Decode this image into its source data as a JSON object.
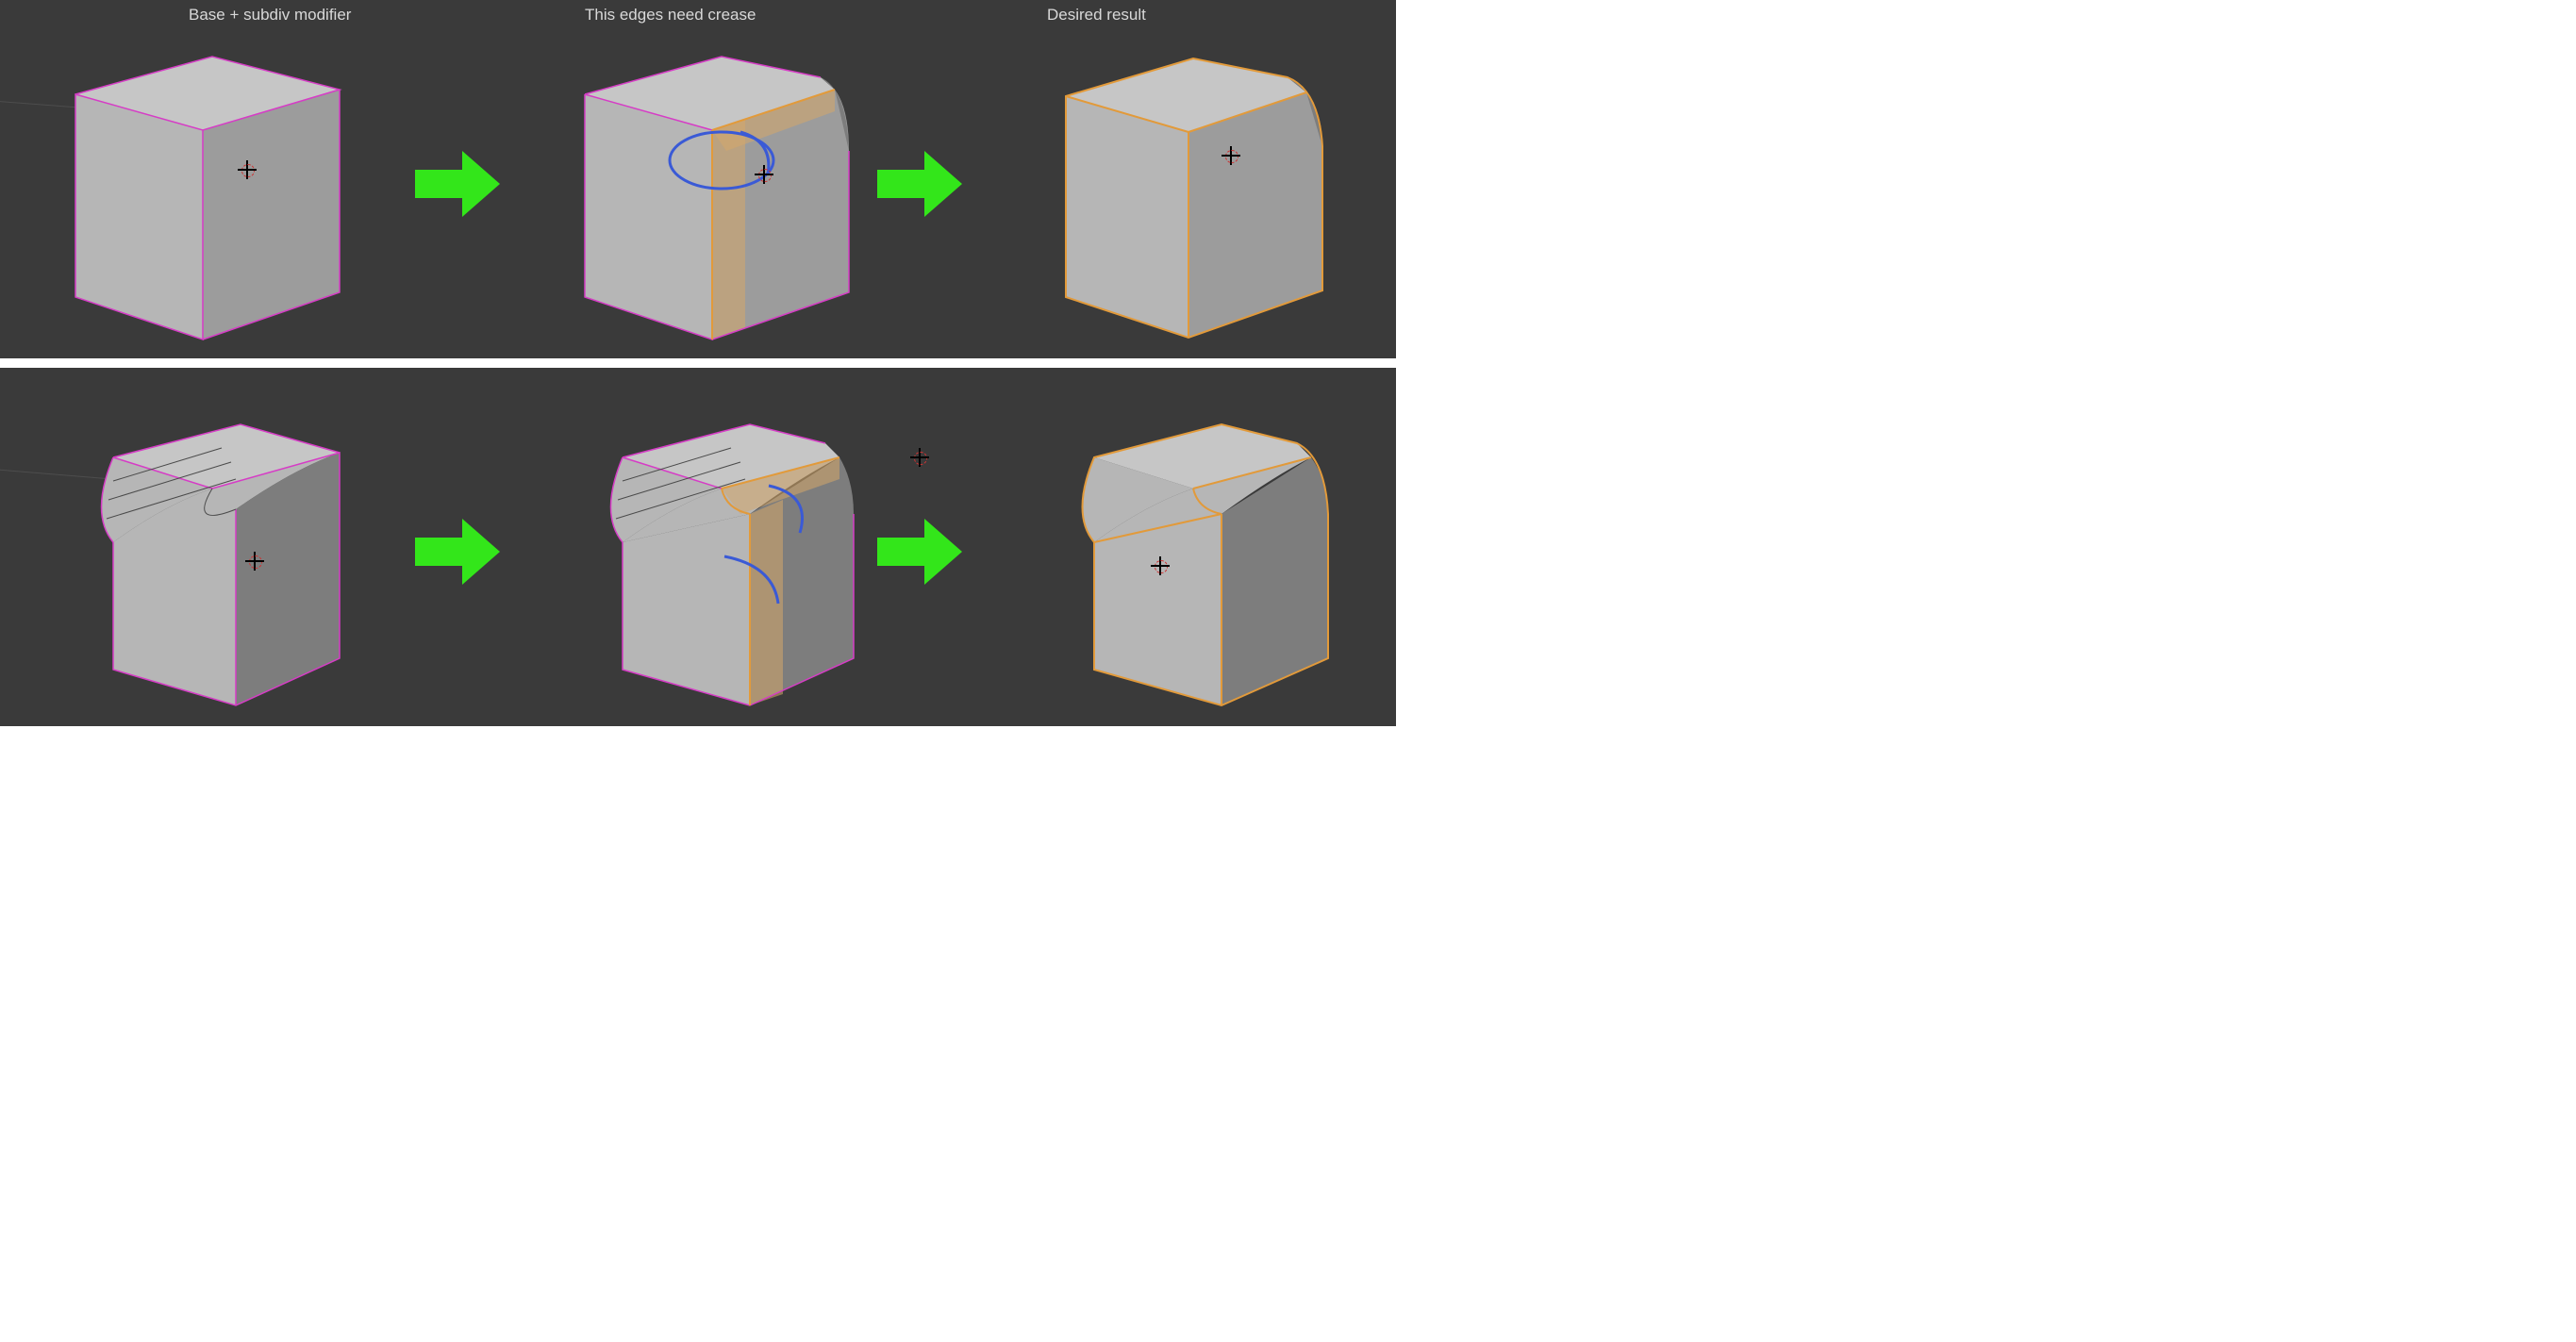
{
  "labels": {
    "col1": "Base + subdiv modifier",
    "col2": "This edges need crease",
    "col3": "Desired result"
  },
  "colors": {
    "bg": "#3a3a3a",
    "edge_default": "#d63cc6",
    "edge_selected": "#e29a3a",
    "annotation": "#3a5ad6",
    "arrow": "#33e61a",
    "face_light": "#c6c6c6",
    "face_mid": "#b6b6b6",
    "face_dark": "#7d7d7d"
  },
  "icons": {
    "arrow": "arrow-right-icon",
    "cursor": "3d-cursor-icon"
  },
  "rows": [
    {
      "variant": "sharp-cube"
    },
    {
      "variant": "beveled-cube"
    }
  ]
}
